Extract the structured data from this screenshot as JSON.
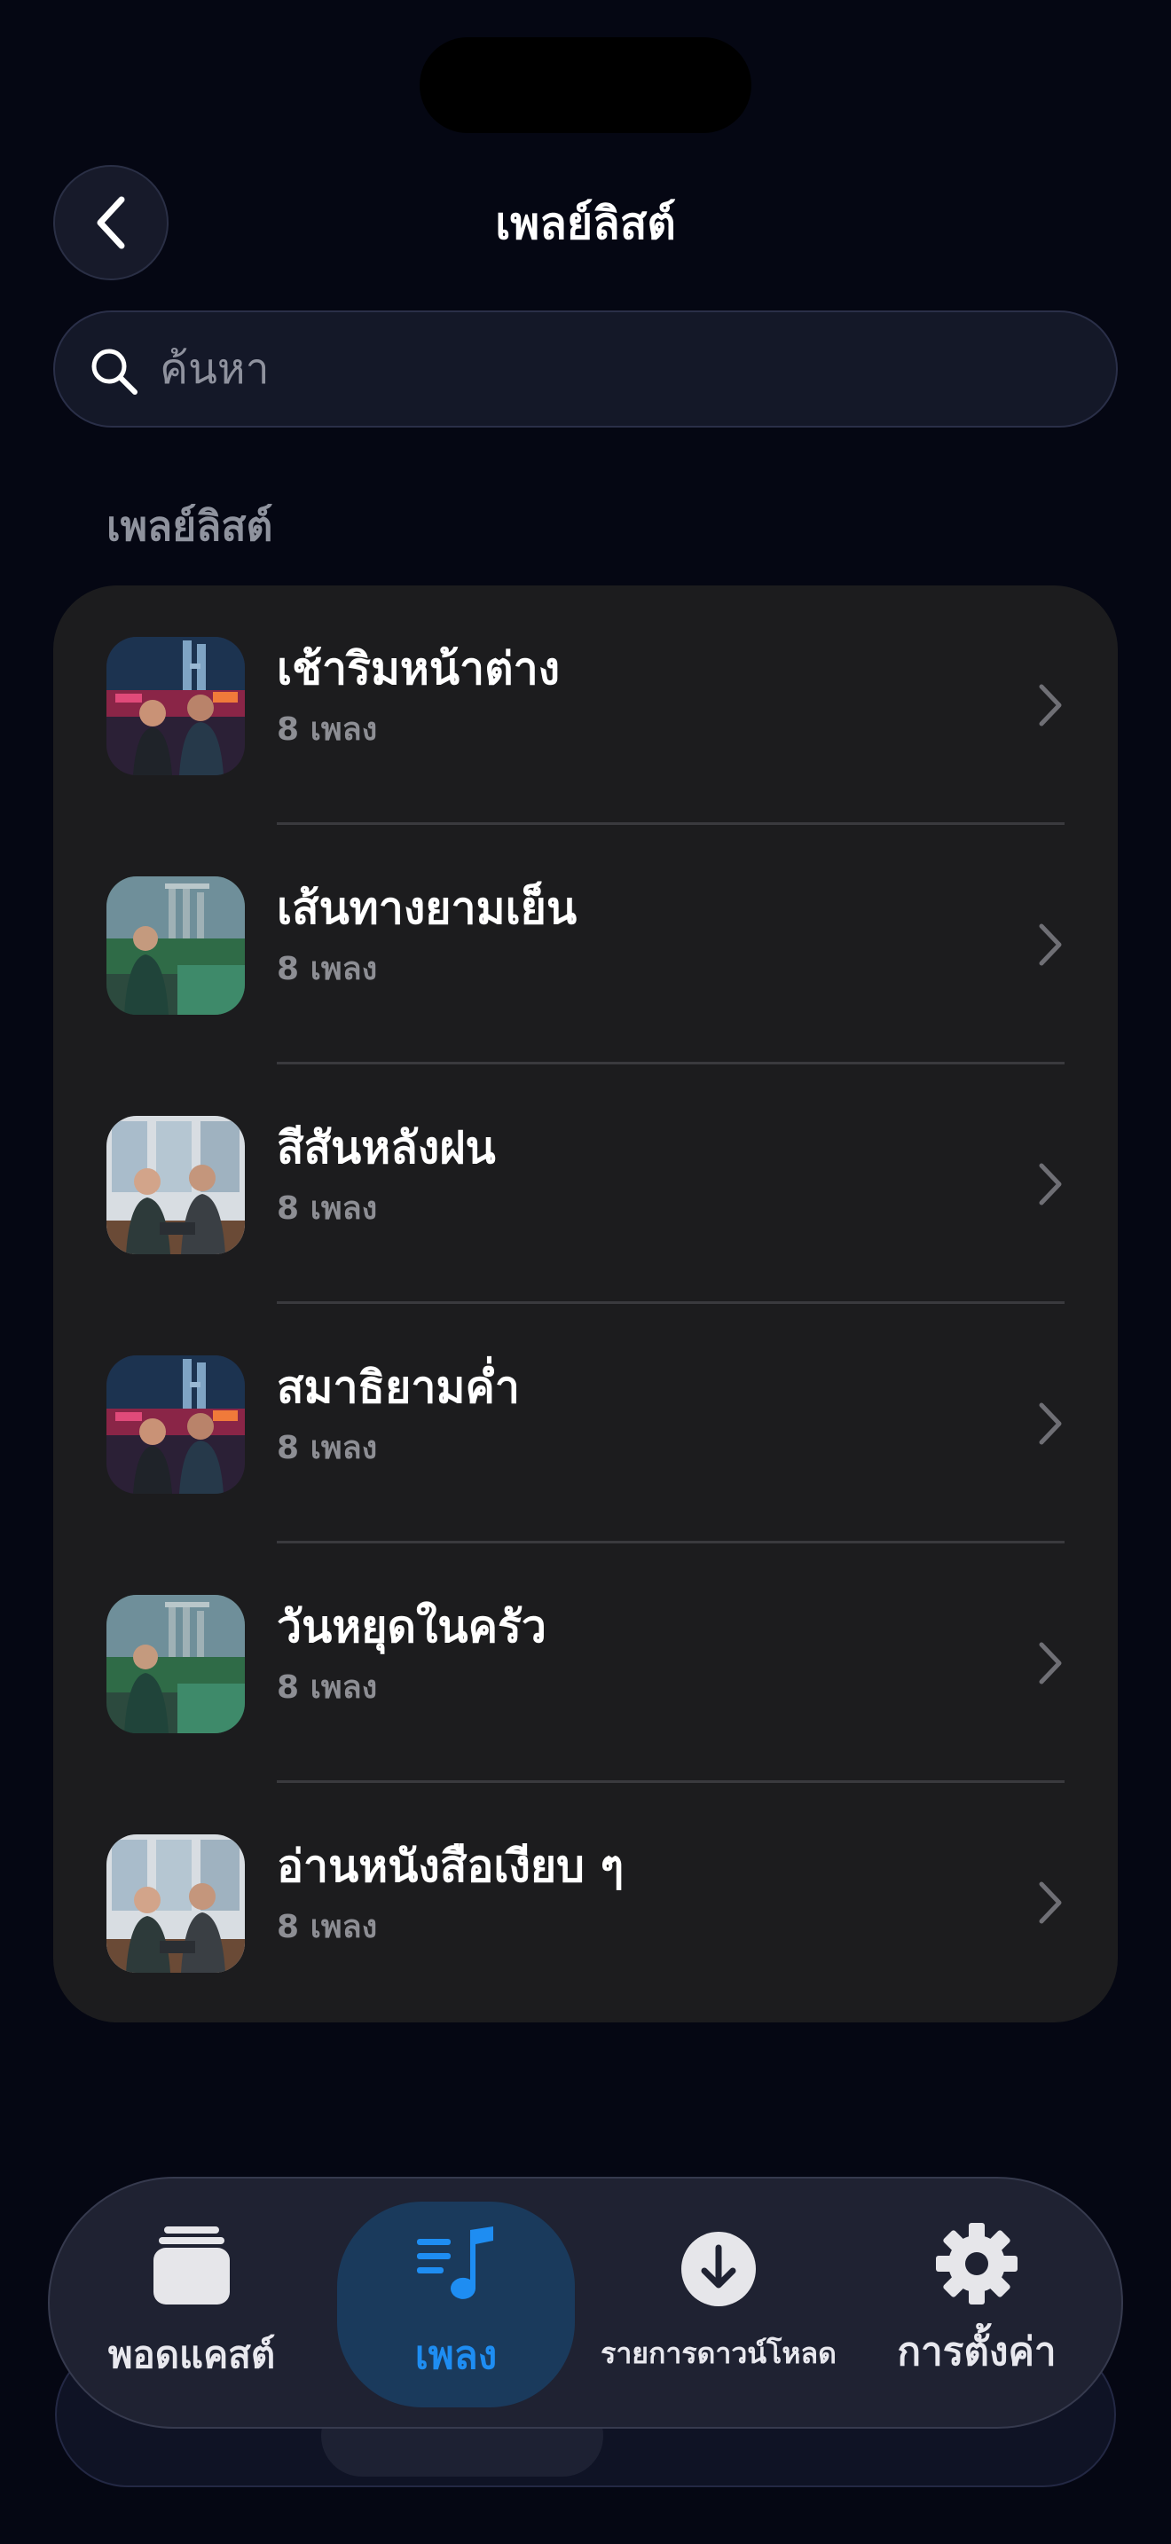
{
  "header": {
    "title": "เพลย์ลิสต์",
    "back_icon": "chevron-left-icon"
  },
  "search": {
    "placeholder": "ค้นหา",
    "icon": "search-icon"
  },
  "section": {
    "label": "เพลย์ลิสต์"
  },
  "playlists": [
    {
      "title": "เช้าริมหน้าต่าง",
      "subtitle": "8 เพลง",
      "thumbnail": "city-night-market-couple"
    },
    {
      "title": "เส้นทางยามเย็น",
      "subtitle": "8 เพลง",
      "thumbnail": "woman-garden-skyline"
    },
    {
      "title": "สีสันหลังฝน",
      "subtitle": "8 เพลง",
      "thumbnail": "cafe-duo-laptop"
    },
    {
      "title": "สมาธิยามค่ำ",
      "subtitle": "8 เพลง",
      "thumbnail": "city-night-market-couple"
    },
    {
      "title": "วันหยุดในครัว",
      "subtitle": "8 เพลง",
      "thumbnail": "woman-garden-skyline"
    },
    {
      "title": "อ่านหนังสือเงียบ ๆ",
      "subtitle": "8 เพลง",
      "thumbnail": "cafe-duo-laptop"
    }
  ],
  "tabbar": {
    "tabs": [
      {
        "label": "พอดแคสต์",
        "icon": "podcast-stack-icon",
        "active": false
      },
      {
        "label": "เพลง",
        "icon": "music-list-icon",
        "active": true
      },
      {
        "label": "รายการดาวน์โหลด",
        "icon": "download-icon",
        "active": false
      },
      {
        "label": "การตั้งค่า",
        "icon": "gear-icon",
        "active": false
      }
    ]
  },
  "colors": {
    "background": "#050713",
    "card": "#1c1c1e",
    "accent": "#1e8df2",
    "secondary_text": "#8d8e94"
  }
}
